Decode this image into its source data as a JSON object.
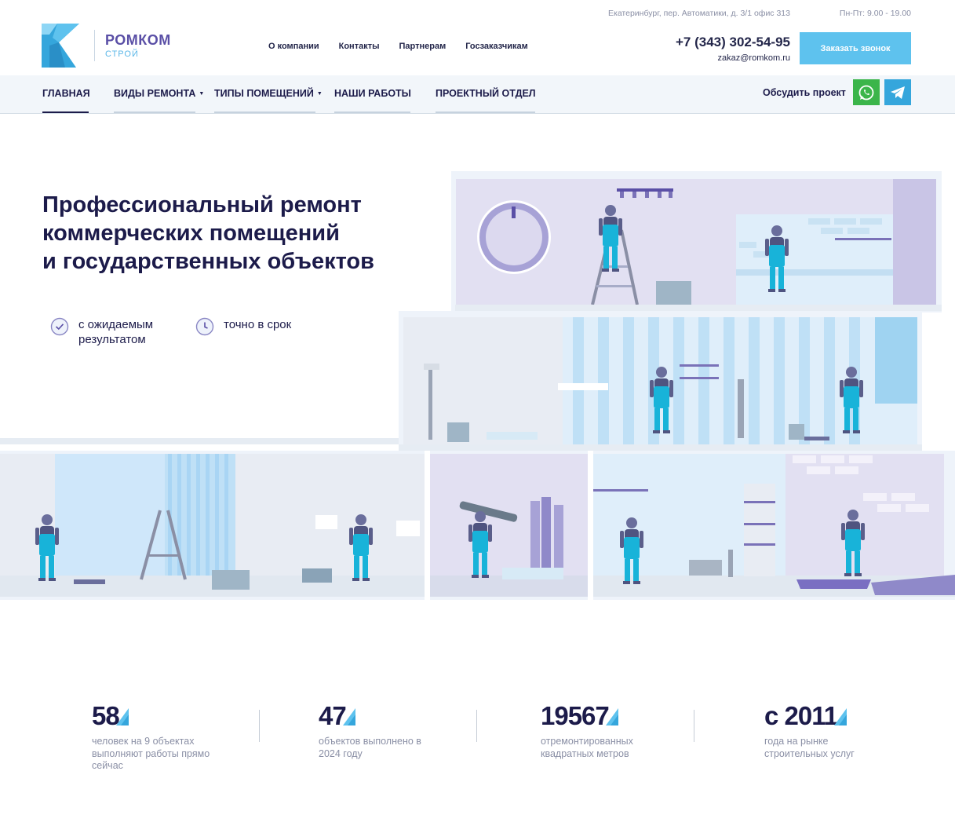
{
  "header": {
    "brand": {
      "name": "РОМКОМ",
      "sub": "СТРОЙ"
    },
    "top_nav": [
      "О компании",
      "Контакты",
      "Партнерам",
      "Госзаказчикам"
    ],
    "address": "Екатеринбург, пер. Автоматики, д. 3/1 офис 313",
    "hours": "Пн-Пт: 9.00 - 19.00",
    "phone": "+7 (343) 302-54-95",
    "email": "zakaz@romkom.ru",
    "callback_label": "Заказать звонок",
    "colors": {
      "accent": "#5ec2ee",
      "brand": "#5a4fa6",
      "dark": "#1c1b4a"
    }
  },
  "main_nav": {
    "items": [
      {
        "label": "ГЛАВНАЯ",
        "active": true
      },
      {
        "label": "ВИДЫ РЕМОНТА",
        "dropdown": true
      },
      {
        "label": "ТИПЫ ПОМЕЩЕНИЙ",
        "dropdown": true
      },
      {
        "label": "НАШИ РАБОТЫ"
      },
      {
        "label": "ПРОЕКТНЫЙ ОТДЕЛ"
      }
    ],
    "discuss_label": "Обсудить проект",
    "social": [
      {
        "name": "whatsapp-icon",
        "color": "#3bb54a"
      },
      {
        "name": "telegram-icon",
        "color": "#35a6dc"
      }
    ]
  },
  "hero": {
    "title_lines": [
      "Профессиональный ремонт",
      "коммерческих помещений",
      "и государственных объектов"
    ],
    "features": [
      {
        "icon": "check-circle-icon",
        "label": "с ожидаемым результатом"
      },
      {
        "icon": "clock-icon",
        "label": "точно в срок"
      }
    ],
    "illustration": "workers-renovation-illustration"
  },
  "stats": [
    {
      "value": "58",
      "desc": "человек на 9 объектах выполняют работы прямо сейчас"
    },
    {
      "value": "47",
      "desc": "объектов выполнено в 2024 году"
    },
    {
      "value": "19567",
      "desc": "отремонтированных квадратных метров"
    },
    {
      "value": "с 2011",
      "desc": "года на рынке строительных услуг"
    }
  ]
}
